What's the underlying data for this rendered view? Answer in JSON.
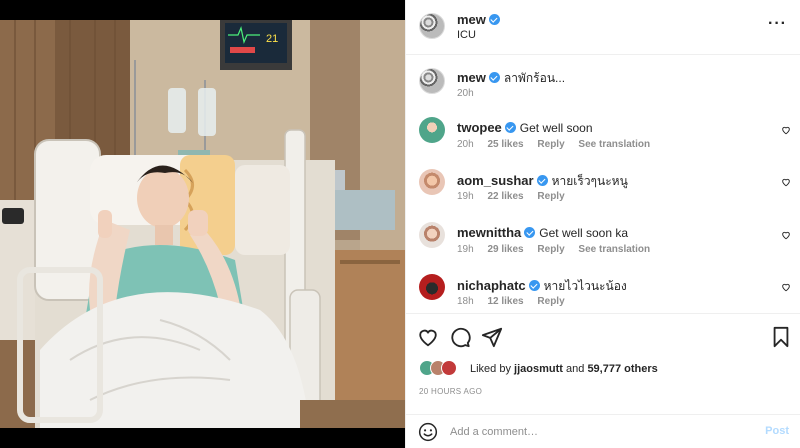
{
  "post": {
    "username": "mew",
    "location": "ICU",
    "caption": "ลาพักร้อน...",
    "caption_time": "20h"
  },
  "comments": [
    {
      "username": "twopee",
      "text": "Get well soon",
      "time": "20h",
      "likes": "25 likes",
      "reply": "Reply",
      "translate": "See translation"
    },
    {
      "username": "aom_sushar",
      "text": "หายเร็วๆนะหนู",
      "time": "19h",
      "likes": "22 likes",
      "reply": "Reply",
      "translate": ""
    },
    {
      "username": "mewnittha",
      "text": "Get well soon ka",
      "time": "19h",
      "likes": "29 likes",
      "reply": "Reply",
      "translate": "See translation"
    },
    {
      "username": "nichaphatc",
      "text": "หายไวไวนะน้อง",
      "time": "18h",
      "likes": "12 likes",
      "reply": "Reply",
      "translate": ""
    }
  ],
  "likes": {
    "prefix": "Liked by",
    "user": "jjaosmutt",
    "and": "and",
    "others": "59,777 others"
  },
  "time_ago": "20 HOURS AGO",
  "add_comment": {
    "placeholder": "Add a comment…",
    "post_label": "Post"
  },
  "monitor": {
    "readout": "21"
  },
  "colors": {
    "verified": "#3897f0",
    "post_disabled": "#b3dbff",
    "secondary_text": "#8e8e8e"
  },
  "icons": [
    "more-icon",
    "verified-icon",
    "heart-icon",
    "comment-icon",
    "share-icon",
    "bookmark-icon",
    "emoji-icon"
  ]
}
